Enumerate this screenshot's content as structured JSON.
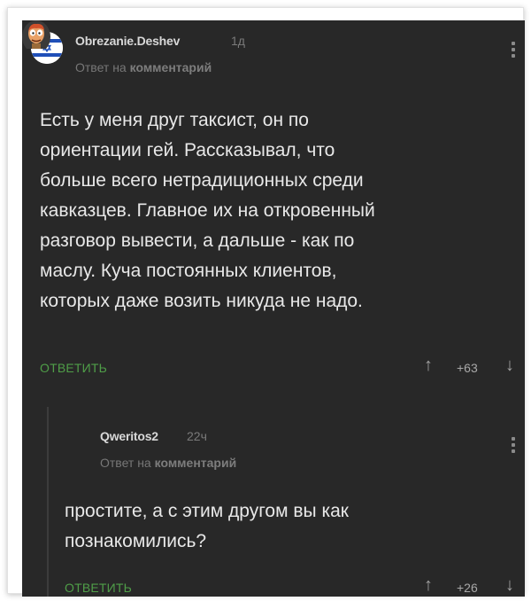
{
  "comments": [
    {
      "username": "Obrezanie.Deshev",
      "time": "1д",
      "reply_prefix": "Ответ на",
      "reply_target": "комментарий",
      "lines": [
        "Есть у меня друг таксист, он по",
        "ориентации гей. Рассказывал, что",
        "больше всего нетрадиционных среди",
        "кавказцев. Главное их на откровенный",
        "разговор вывести, а дальше - как по",
        "маслу. Куча постоянных клиентов,",
        "которых даже возить никуда не надо."
      ],
      "reply_label": "ОТВЕТИТЬ",
      "score": "+63",
      "avatar_icon": "israel-flag-icon"
    },
    {
      "username": "Qweritos2",
      "time": "22ч",
      "reply_prefix": "Ответ на",
      "reply_target": "комментарий",
      "lines": [
        "простите, а с этим другом вы как",
        "познакомились?"
      ],
      "reply_label": "ОТВЕТИТЬ",
      "score": "+26",
      "avatar_icon": "cartoon-character-icon"
    }
  ],
  "icons": {
    "upvote": "↑",
    "downvote": "↓"
  },
  "colors": {
    "background": "#282828",
    "accent": "#4f9e48",
    "text": "#e8e8e8"
  }
}
